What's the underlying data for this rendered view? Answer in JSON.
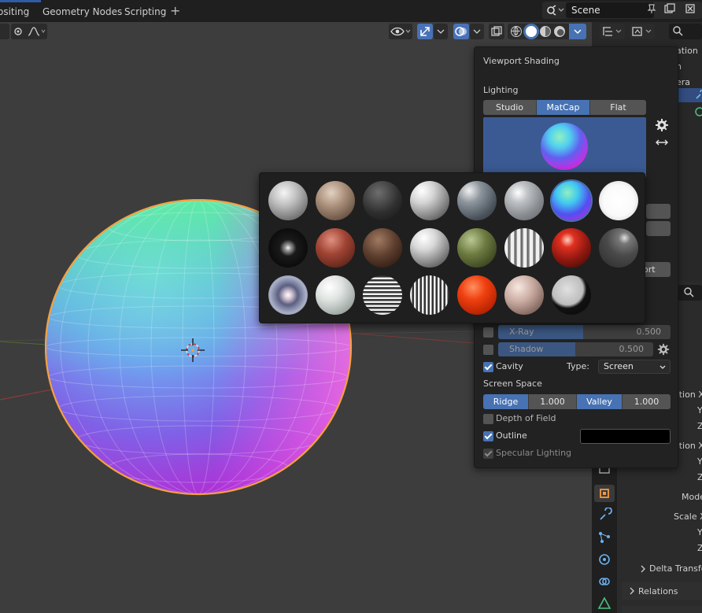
{
  "topbar": {
    "tabs": [
      "ositing",
      "Geometry Nodes",
      "Scripting"
    ],
    "add_label": "+",
    "scene_name": "Scene"
  },
  "popover": {
    "title": "Viewport Shading",
    "lighting_label": "Lighting",
    "lighting_modes": [
      "Studio",
      "MatCap",
      "Flat"
    ],
    "lighting_active": "MatCap",
    "xray": {
      "label": "X-Ray",
      "value": "0.500",
      "checked": false
    },
    "shadow": {
      "label": "Shadow",
      "value": "0.500",
      "checked": false
    },
    "cavity": {
      "label": "Cavity",
      "checked": true,
      "type_label": "Type:",
      "type_value": "Screen"
    },
    "screen_space_label": "Screen Space",
    "ridge": {
      "label": "Ridge",
      "value": "1.000"
    },
    "valley": {
      "label": "Valley",
      "value": "1.000"
    },
    "depth_of_field": {
      "label": "Depth of Field",
      "checked": false
    },
    "outline": {
      "label": "Outline",
      "checked": true,
      "color": "#000000"
    },
    "specular_lighting": {
      "label": "Specular Lighting",
      "checked": true
    }
  },
  "outliner_partial": [
    "ation",
    "n",
    "era"
  ],
  "properties_partial": {
    "ort_label": "ort",
    "rows": [
      "ation X",
      "Y",
      "Z",
      "ation X",
      "Y",
      "Z",
      "Mode",
      "Scale X",
      "Y",
      "Z"
    ],
    "delta_transform": "Delta Transfo",
    "relations": "Relations"
  },
  "matcap_count": 23,
  "colors": {
    "accent": "#4772b3",
    "popover_bg": "#222222",
    "viewport_bg": "#3d3d3d",
    "selection_outline": "#f5a040"
  }
}
